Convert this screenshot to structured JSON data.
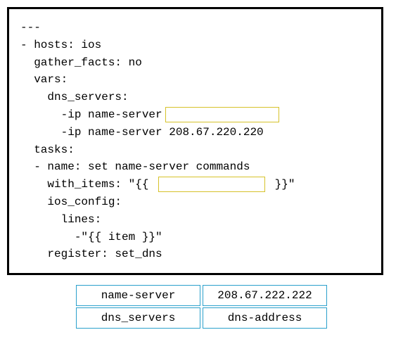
{
  "code": {
    "l1": "---",
    "l2": "- hosts: ios",
    "l3": "  gather_facts: no",
    "l4": "  vars:",
    "l5": "",
    "l6": "    dns_servers:",
    "l7a": "      -ip name-server",
    "l8": "      -ip name-server 208.67.220.220",
    "l9": "",
    "l10": "  tasks:",
    "l11": "",
    "l12": "  - name: set name-server commands",
    "l13a": "    with_items: \"{{ ",
    "l13b": " }}\"",
    "l14": "    ios_config:",
    "l15": "      lines:",
    "l16": "        -\"{{ item }}\"",
    "l17": "    register: set_dns"
  },
  "options": {
    "r1c1": "name-server",
    "r1c2": "208.67.222.222",
    "r2c1": "dns_servers",
    "r2c2": "dns-address"
  }
}
